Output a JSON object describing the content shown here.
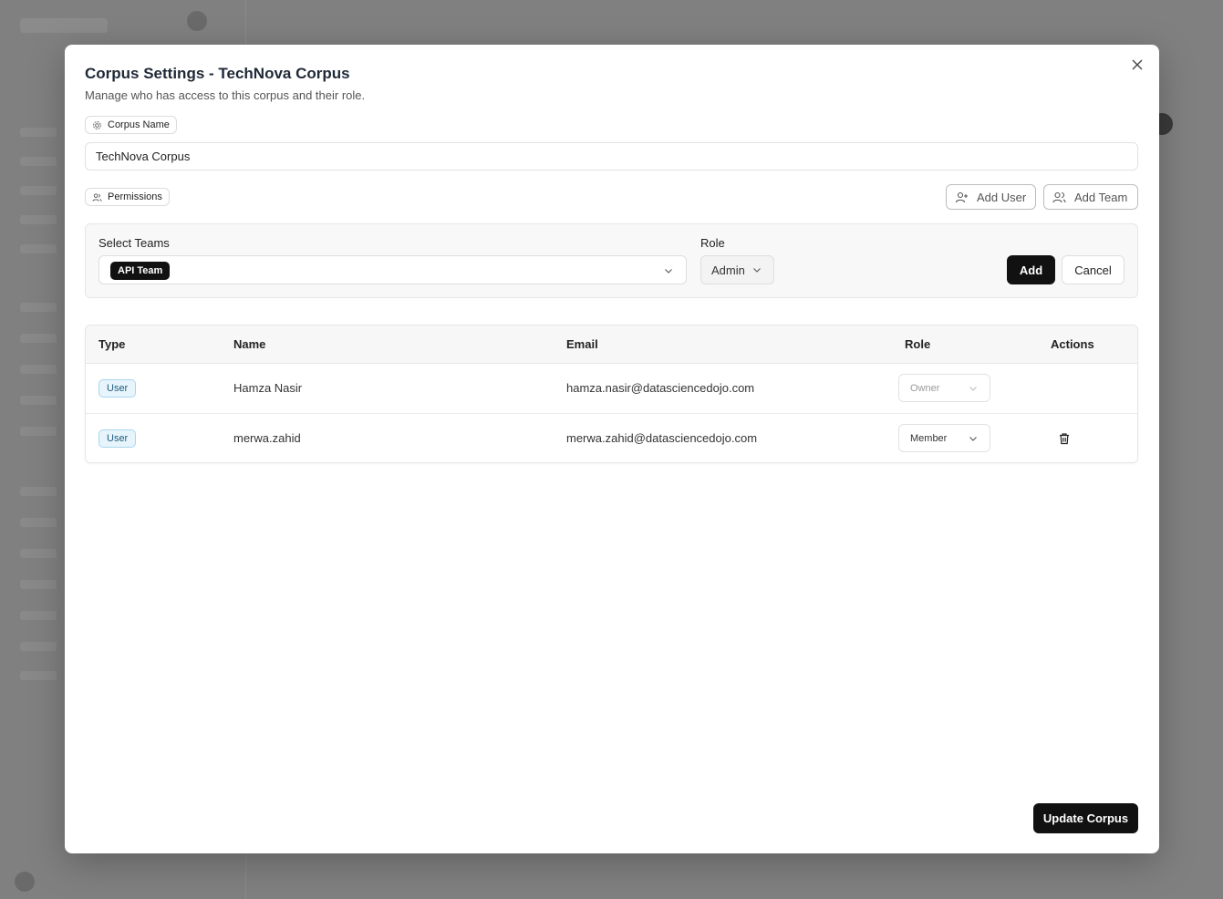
{
  "modal": {
    "title": "Corpus Settings - TechNova Corpus",
    "subtitle": "Manage who has access to this corpus and their role."
  },
  "corpus_name": {
    "label": "Corpus Name",
    "icon": "gear-icon",
    "value": "TechNova Corpus"
  },
  "permissions": {
    "label": "Permissions",
    "icon": "users-icon",
    "add_user_label": "Add User",
    "add_team_label": "Add Team"
  },
  "add_panel": {
    "teams_label": "Select Teams",
    "selected_team": "API Team",
    "role_label": "Role",
    "role_value": "Admin",
    "add_label": "Add",
    "cancel_label": "Cancel"
  },
  "table": {
    "headers": [
      "Type",
      "Name",
      "Email",
      "Role",
      "Actions"
    ],
    "rows": [
      {
        "type": "User",
        "name": "Hamza Nasir",
        "email": "hamza.nasir@datasciencedojo.com",
        "role": "Owner",
        "role_editable": false,
        "deletable": false
      },
      {
        "type": "User",
        "name": "merwa.zahid",
        "email": "merwa.zahid@datasciencedojo.com",
        "role": "Member",
        "role_editable": true,
        "deletable": true
      }
    ]
  },
  "footer": {
    "update_label": "Update Corpus"
  },
  "colors": {
    "primary": "#111111",
    "badge_bg": "#e7f4fb",
    "badge_border": "#a8d6ee",
    "overlay": "#808080"
  }
}
